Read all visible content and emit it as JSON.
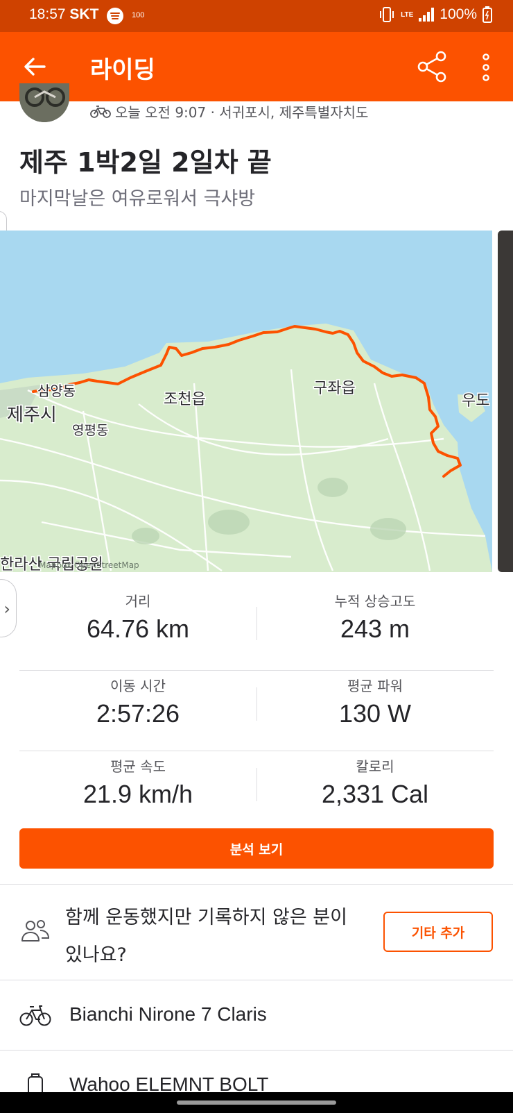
{
  "status_bar": {
    "time": "18:57",
    "carrier": "SKT",
    "notif": "100",
    "net": "LTE",
    "battery": "100%"
  },
  "app_bar": {
    "title": "라이딩",
    "back_icon": "arrow-left-icon",
    "share_icon": "share-icon",
    "more_icon": "more-vert-icon"
  },
  "activity": {
    "meta": "오늘 오전 9:07 · 서귀포시, 제주특별자치도",
    "title": "제주 1박2일 2일차 끝",
    "description": "마지막날은 여유로워서 극샤방"
  },
  "map": {
    "labels": {
      "jeju_city": "제주시",
      "samyang": "삼양동",
      "yeongpyeong": "영평동",
      "jocheon": "조천읍",
      "gujwa": "구좌읍",
      "udo": "우도",
      "hallasan": "한라산 국립공원",
      "attribution": "Mapbox OpenStreetMap"
    },
    "colors": {
      "water": "#a8d8f0",
      "land": "#d8eccd",
      "route": "#fc5200"
    }
  },
  "stats": [
    {
      "left": {
        "label": "거리",
        "value": "64.76 km"
      },
      "right": {
        "label": "누적 상승고도",
        "value": "243 m"
      }
    },
    {
      "left": {
        "label": "이동 시간",
        "value": "2:57:26"
      },
      "right": {
        "label": "평균 파워",
        "value": "130 W"
      }
    },
    {
      "left": {
        "label": "평균 속도",
        "value": "21.9 km/h"
      },
      "right": {
        "label": "칼로리",
        "value": "2,331 Cal"
      }
    }
  ],
  "analysis_button": "분석 보기",
  "together": {
    "text": "함께 운동했지만 기록하지 않은 분이 있나요?",
    "button": "기타 추가"
  },
  "gear": {
    "bike": "Bianchi Nirone 7 Claris",
    "device": "Wahoo ELEMNT BOLT"
  },
  "brand_color": "#fc5200"
}
